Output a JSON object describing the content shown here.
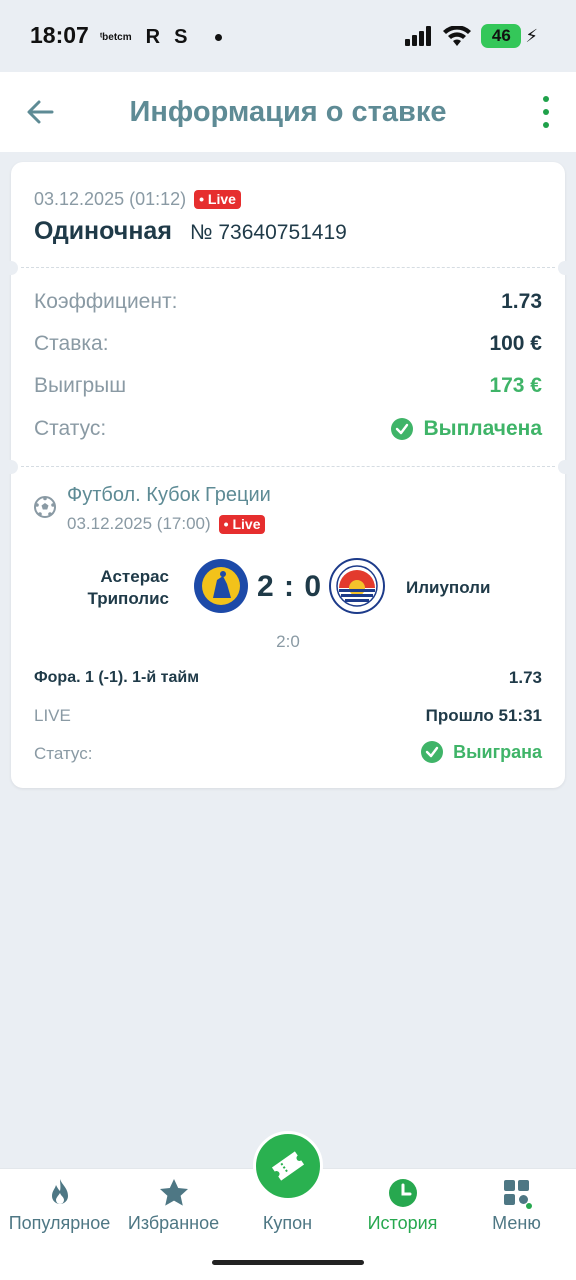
{
  "status_bar": {
    "time": "18:07",
    "carrier_small": "ᵗbetcm",
    "app_r": "R",
    "app_s": "S",
    "battery": "46",
    "icons": [
      "signal-icon",
      "wifi-icon",
      "battery-icon",
      "charging-icon"
    ]
  },
  "header": {
    "title": "Информация о ставке",
    "back_icon": "arrow-left-icon",
    "menu_icon": "more-vertical-icon"
  },
  "bet": {
    "date": "03.12.2025 (01:12)",
    "live_badge": "Live",
    "type": "Одиночная",
    "number": "№ 73640751419",
    "rows": {
      "coef_label": "Коэффициент:",
      "coef_value": "1.73",
      "stake_label": "Ставка:",
      "stake_value": "100 €",
      "win_label": "Выигрыш",
      "win_value": "173 €",
      "status_label": "Статус:",
      "status_value": "Выплачена"
    }
  },
  "event": {
    "sport_icon": "football-icon",
    "title": "Футбол. Кубок Греции",
    "date": "03.12.2025 (17:00)",
    "live_badge": "Live",
    "home_line1": "Астерас",
    "home_line2": "Триполис",
    "score": "2 : 0",
    "away": "Илиуполи",
    "half_score": "2:0",
    "market": "Фора. 1 (-1). 1-й тайм",
    "market_odd": "1.73",
    "live_label": "LIVE",
    "elapsed": "Прошло 51:31",
    "status_label": "Статус:",
    "status_value": "Выиграна"
  },
  "nav": {
    "items": [
      {
        "label": "Популярное",
        "icon": "flame-icon"
      },
      {
        "label": "Избранное",
        "icon": "star-icon"
      },
      {
        "label": "Купон",
        "icon": "ticket-icon"
      },
      {
        "label": "История",
        "icon": "clock-icon"
      },
      {
        "label": "Меню",
        "icon": "grid-icon"
      }
    ]
  },
  "colors": {
    "accent_green": "#2ab150",
    "title_teal": "#5e8b95",
    "live_red": "#e62e2e",
    "background": "#eaeef3"
  }
}
